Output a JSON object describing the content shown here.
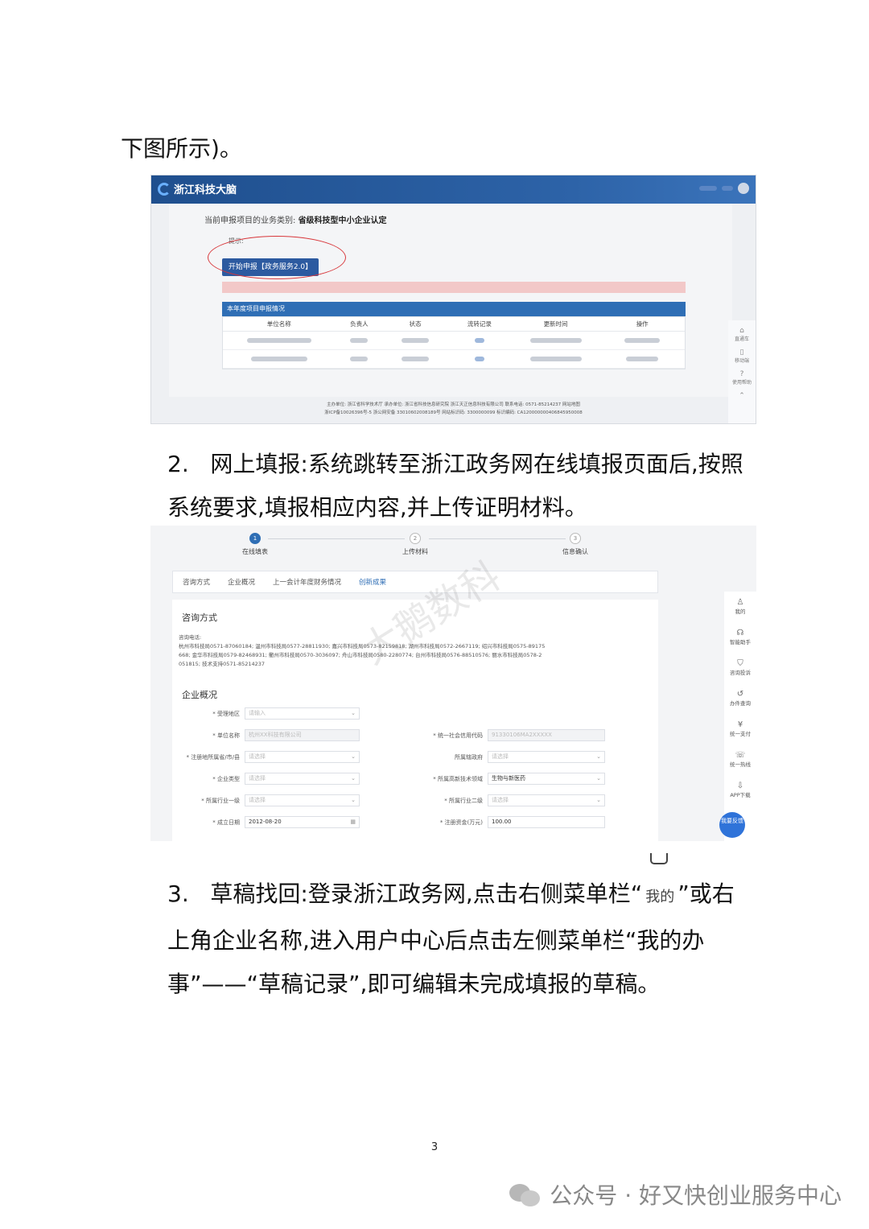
{
  "intro_tail": "下图所示)。",
  "shot1": {
    "logo": "浙江科技大脑",
    "business_type_label": "当前申报项目的业务类别:",
    "business_type_value": "省级科技型中小企业认定",
    "hint": "提示:",
    "start_button": "开始申报【政务服务2.0】",
    "table_title": "本年度项目申报情况",
    "columns": [
      "单位名称",
      "负责人",
      "状态",
      "流转记录",
      "更新时间",
      "操作"
    ],
    "side": [
      "直通车",
      "移动端",
      "使用帮助"
    ],
    "footer_line1": "主办单位: 浙江省科学技术厅  承办单位: 浙江省科技信息研究院 浙江天正信息科技有限公司 联系电话: 0571-85214237 网站地图",
    "footer_line2": "浙ICP备10026396号-5  浙公网安备 33010602008189号  网站标识码: 3300000099  标识编码: CA120000000406845950008"
  },
  "item2": {
    "num": "2.",
    "text": "网上填报:系统跳转至浙江政务网在线填报页面后,按照系统要求,填报相应内容,并上传证明材料。"
  },
  "shot2": {
    "steps": [
      {
        "num": "1",
        "label": "在线填表"
      },
      {
        "num": "2",
        "label": "上传材料"
      },
      {
        "num": "3",
        "label": "信息确认"
      }
    ],
    "tabs": [
      "咨询方式",
      "企业概况",
      "上一会计年度财务情况",
      "创新成果"
    ],
    "watermark": "大鹅数科",
    "consult_title": "咨询方式",
    "consult_phone_label": "咨询电话:",
    "consult_line1": "杭州市科技局0571-87060184; 温州市科技局0577-28811930; 嘉兴市科技局0573-82159818; 湖州市科技局0572-2667119; 绍兴市科技局0575-89175",
    "consult_line2": "668; 金华市科技局0579-82468931; 衢州市科技局0570-3036097; 舟山市科技局0580-2280774; 台州市科技局0576-88510576; 丽水市科技局0578-2",
    "consult_line3": "051815; 技术支持0571-85214237",
    "company_title": "企业概况",
    "fields": {
      "region_label": "* 受理地区",
      "region_ph": "请输入",
      "name_label": "* 单位名称",
      "name_val": "杭州XX科技有限公司",
      "credit_label": "* 统一社会信用代码",
      "credit_val": "91330106MA2XXXXX",
      "reg_label": "* 注册地所属省/市/县",
      "reg_ph": "请选择",
      "gov_label": "所属辖政府",
      "gov_ph": "请选择",
      "type_label": "* 企业类型",
      "type_ph": "请选择",
      "hitech_label": "* 所属高新技术领域",
      "hitech_val": "生物与新医药",
      "ind1_label": "* 所属行业一级",
      "ind1_ph": "请选择",
      "ind2_label": "* 所属行业二级",
      "ind2_ph": "请选择",
      "date_label": "* 成立日期",
      "date_val": "2012-08-20",
      "capital_label": "* 注册资金(万元)",
      "capital_val": "100.00"
    },
    "side": [
      "我的",
      "智能助手",
      "咨询投诉",
      "办件查询",
      "统一支付",
      "统一热线",
      "APP下载"
    ],
    "feedback": "我要反馈"
  },
  "item3": {
    "num": "3.",
    "text_a": "草稿找回:登录浙江政务网,点击右侧菜单栏“",
    "mine": "我的",
    "text_b": "”或右上角企业名称,进入用户中心后点击左侧菜单栏“我的办事”——“草稿记录”,即可编辑未完成填报的草稿。"
  },
  "page_number": "3",
  "account": "公众号 · 好又快创业服务中心"
}
